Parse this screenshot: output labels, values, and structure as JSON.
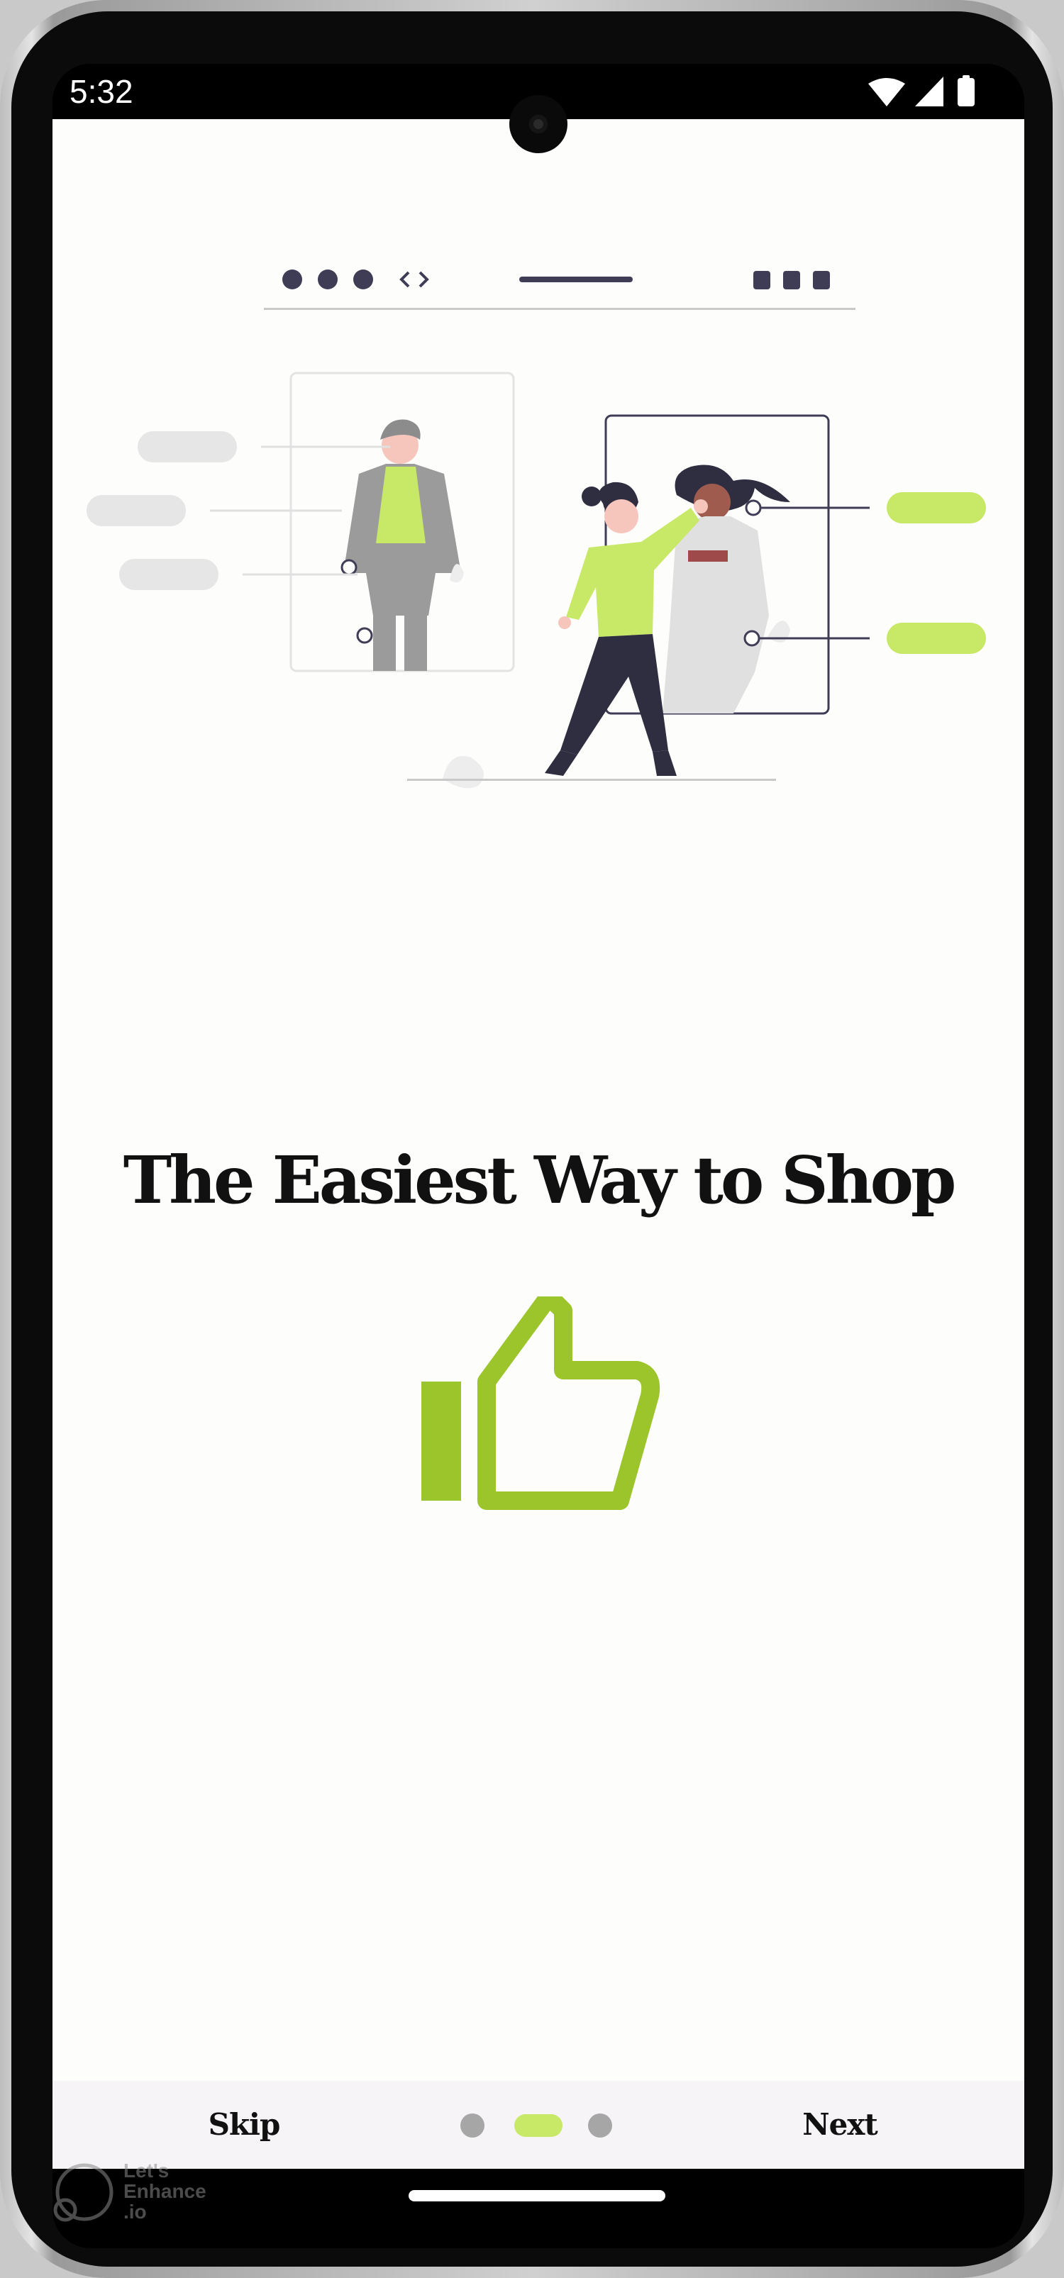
{
  "status_bar": {
    "time": "5:32",
    "icons": [
      "wifi-icon",
      "cellular-signal-icon",
      "battery-icon"
    ]
  },
  "onboarding": {
    "title": "The Easiest Way to Shop",
    "illustration": "person-shopping-clothes-illustration",
    "icon": "thumbs-up-icon",
    "accent_color": "#c8e867",
    "icon_color": "#9bc52a"
  },
  "footer": {
    "skip_label": "Skip",
    "next_label": "Next",
    "page_count": 3,
    "current_page": 2
  },
  "watermark": {
    "text": "Let's\nEnhance\n.io"
  }
}
